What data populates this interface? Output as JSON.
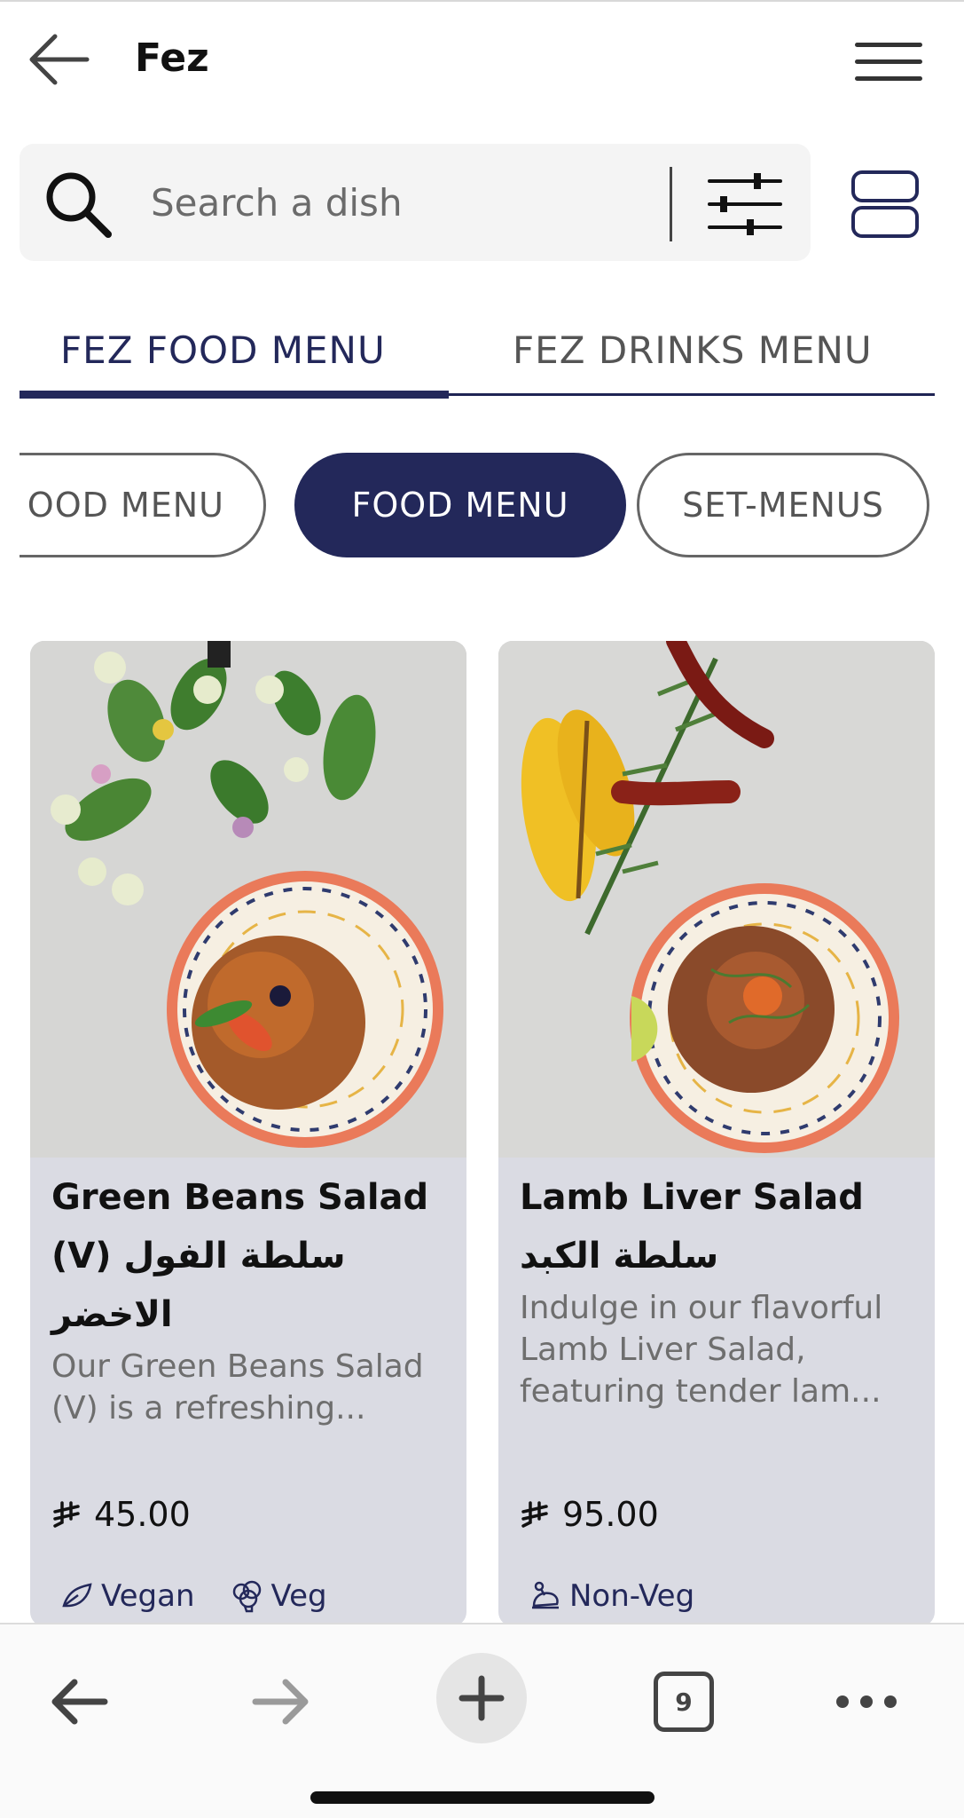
{
  "header": {
    "title": "Fez"
  },
  "search": {
    "placeholder": "Search a dish"
  },
  "menu_tabs": [
    {
      "label": "FEZ FOOD MENU",
      "active": true
    },
    {
      "label": "FEZ DRINKS MENU",
      "active": false
    }
  ],
  "category_chips": [
    {
      "label": "OOD MENU",
      "active": false
    },
    {
      "label": "FOOD MENU",
      "active": true
    },
    {
      "label": "SET-MENUS",
      "active": false
    }
  ],
  "dishes": [
    {
      "title": "Green Beans Salad (V) سلطة الفول الاخضر",
      "description": "Our Green Beans Salad (V) is a refreshing...",
      "price": "45.00",
      "tags": [
        {
          "icon": "leaf-icon",
          "label": "Vegan"
        },
        {
          "icon": "broccoli-icon",
          "label": "Veg"
        }
      ]
    },
    {
      "title": "Lamb Liver Salad سلطة الكبد",
      "description": "Indulge in our flavorful Lamb Liver Salad, featuring tender lam...",
      "price": "95.00",
      "tags": [
        {
          "icon": "chicken-icon",
          "label": "Non-Veg"
        }
      ]
    }
  ],
  "browser_bar": {
    "tab_count": "9"
  },
  "colors": {
    "accent": "#23285a",
    "card_bg": "#dadbe3",
    "search_bg": "#f4f4f4"
  }
}
